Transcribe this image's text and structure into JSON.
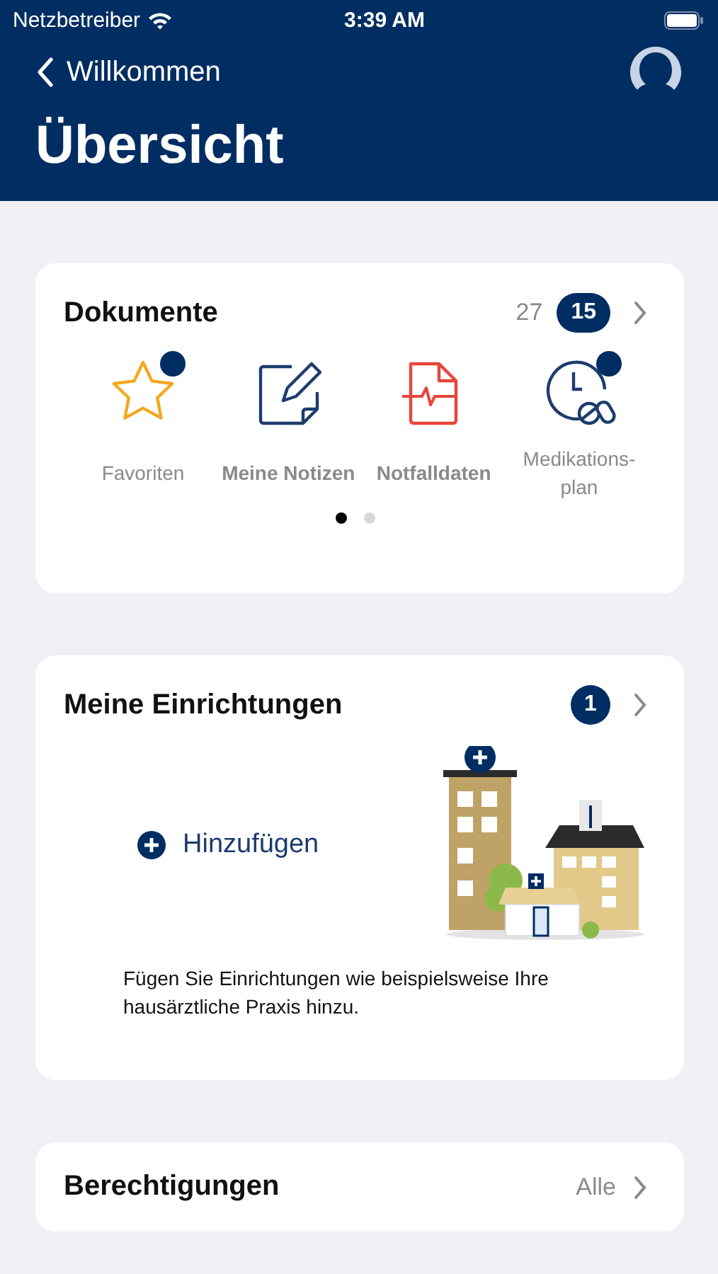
{
  "status_bar": {
    "carrier": "Netzbetreiber",
    "time": "3:39 AM"
  },
  "nav": {
    "back": "Willkommen",
    "title": "Übersicht"
  },
  "documents": {
    "title": "Dokumente",
    "count": "27",
    "badge": "15",
    "tiles": [
      {
        "kind": "star",
        "label": "Favoriten",
        "dot": true,
        "emphasized": false
      },
      {
        "kind": "note",
        "label": "Meine Notizen",
        "dot": false,
        "emphasized": true
      },
      {
        "kind": "emergency",
        "label": "Notfalldaten",
        "dot": false,
        "emphasized": true
      },
      {
        "kind": "medication",
        "label": "Medikations-plan",
        "dot": true,
        "emphasized": false
      }
    ],
    "pages": [
      {
        "selected": true
      },
      {
        "selected": false
      }
    ]
  },
  "facilities": {
    "title": "Meine Einrichtungen",
    "badge": "1",
    "add": "Hinzufügen",
    "hint": "Fügen Sie Einrichtungen wie beispielsweise Ihre hausärztliche Praxis hinzu."
  },
  "permissions": {
    "title": "Berechtigungen",
    "value": "Alle"
  }
}
